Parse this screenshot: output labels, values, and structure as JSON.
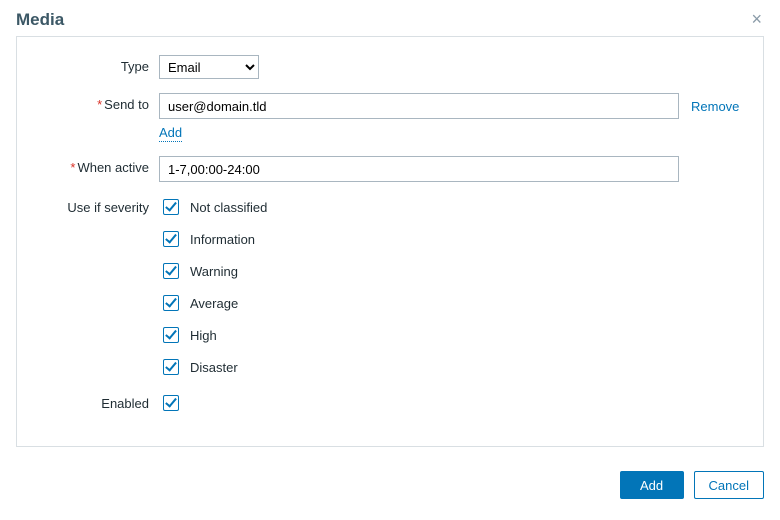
{
  "dialog": {
    "title": "Media",
    "close_label": "×"
  },
  "form": {
    "type": {
      "label": "Type",
      "selected": "Email",
      "options": [
        "Email"
      ]
    },
    "send_to": {
      "label": "Send to",
      "required": true,
      "value": "user@domain.tld",
      "remove_label": "Remove",
      "add_label": "Add"
    },
    "when_active": {
      "label": "When active",
      "required": true,
      "value": "1-7,00:00-24:00"
    },
    "severity": {
      "label": "Use if severity",
      "items": [
        {
          "label": "Not classified",
          "checked": true
        },
        {
          "label": "Information",
          "checked": true
        },
        {
          "label": "Warning",
          "checked": true
        },
        {
          "label": "Average",
          "checked": true
        },
        {
          "label": "High",
          "checked": true
        },
        {
          "label": "Disaster",
          "checked": true
        }
      ]
    },
    "enabled": {
      "label": "Enabled",
      "checked": true
    }
  },
  "footer": {
    "add_label": "Add",
    "cancel_label": "Cancel"
  },
  "colors": {
    "accent": "#0275b8",
    "border": "#d9dfe3",
    "text": "#1f2c33",
    "required": "#d93025"
  }
}
